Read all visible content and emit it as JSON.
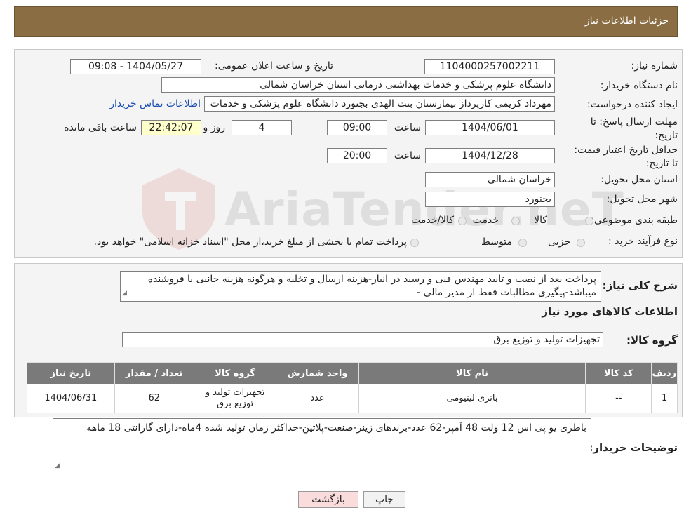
{
  "header": {
    "title": "جزئیات اطلاعات نیاز"
  },
  "form": {
    "need_number": {
      "label": "شماره نیاز:",
      "value": "1104000257002211"
    },
    "announce_datetime": {
      "label": "تاریخ و ساعت اعلان عمومی:",
      "value": "1404/05/27 - 09:08"
    },
    "buyer_org": {
      "label": "نام دستگاه خریدار:",
      "value": "دانشگاه علوم پزشکی و خدمات بهداشتی درمانی استان خراسان شمالی"
    },
    "requester": {
      "label": "ایجاد کننده درخواست:",
      "value": "مهرداد کریمی کارپرداز بیمارستان بنت الهدی بجنورد دانشگاه علوم پزشکی و خدمات",
      "contact_link": "اطلاعات تماس خریدار"
    },
    "response_deadline": {
      "label": "مهلت ارسال پاسخ: تا تاریخ:",
      "date": "1404/06/01",
      "time_label": "ساعت",
      "time": "09:00",
      "days": "4",
      "days_label": "روز و",
      "remaining": "22:42:07",
      "remaining_label": "ساعت باقی مانده"
    },
    "price_validity": {
      "label": "حداقل تاریخ اعتبار قیمت: تا تاریخ:",
      "date": "1404/12/28",
      "time_label": "ساعت",
      "time": "20:00"
    },
    "province": {
      "label": "استان محل تحویل:",
      "value": "خراسان شمالی"
    },
    "city": {
      "label": "شهر محل تحویل:",
      "value": "بجنورد"
    },
    "category": {
      "label": "طبقه بندی موضوعی:",
      "options": [
        "کالا",
        "خدمت",
        "کالا/خدمت"
      ]
    },
    "purchase_process": {
      "label": "نوع فرآیند خرید :",
      "options": [
        "جزیی",
        "متوسط"
      ],
      "note": "پرداخت تمام یا بخشی از مبلغ خرید،از محل \"اسناد خزانه اسلامی\" خواهد بود."
    }
  },
  "description": {
    "label": "شرح کلی نیاز:",
    "text": "پرداخت بعد از نصب و تایید مهندس فنی و رسید در انبار-هزینه ارسال و تخلیه و هرگونه هزینه جانبی با فروشنده میباشد-پیگیری مطالبات فقط از مدیر مالی -"
  },
  "goods": {
    "section_title": "اطلاعات کالاهای مورد نیاز",
    "group_label": "گروه کالا:",
    "group_value": "تجهیزات تولید و توزیع برق",
    "table": {
      "headers": [
        "ردیف",
        "کد کالا",
        "نام کالا",
        "واحد شمارش",
        "گروه کالا",
        "تعداد / مقدار",
        "تاریخ نیاز"
      ],
      "rows": [
        [
          "1",
          "--",
          "باتری لیتیومی",
          "عدد",
          "تجهیزات تولید و توزیع برق",
          "62",
          "1404/06/31"
        ]
      ]
    }
  },
  "buyer_notes": {
    "label": "توضیحات خریدار:",
    "text": "باطری یو پی اس 12 ولت 48 آمپر-62 عدد-برندهای زینر-صنعت-پلاتین-حداکثر زمان تولید شده 4ماه-دارای گارانتی 18 ماهه"
  },
  "buttons": {
    "print": "چاپ",
    "back": "بازگشت"
  },
  "watermark": {
    "text": "AriaTender.neT"
  }
}
